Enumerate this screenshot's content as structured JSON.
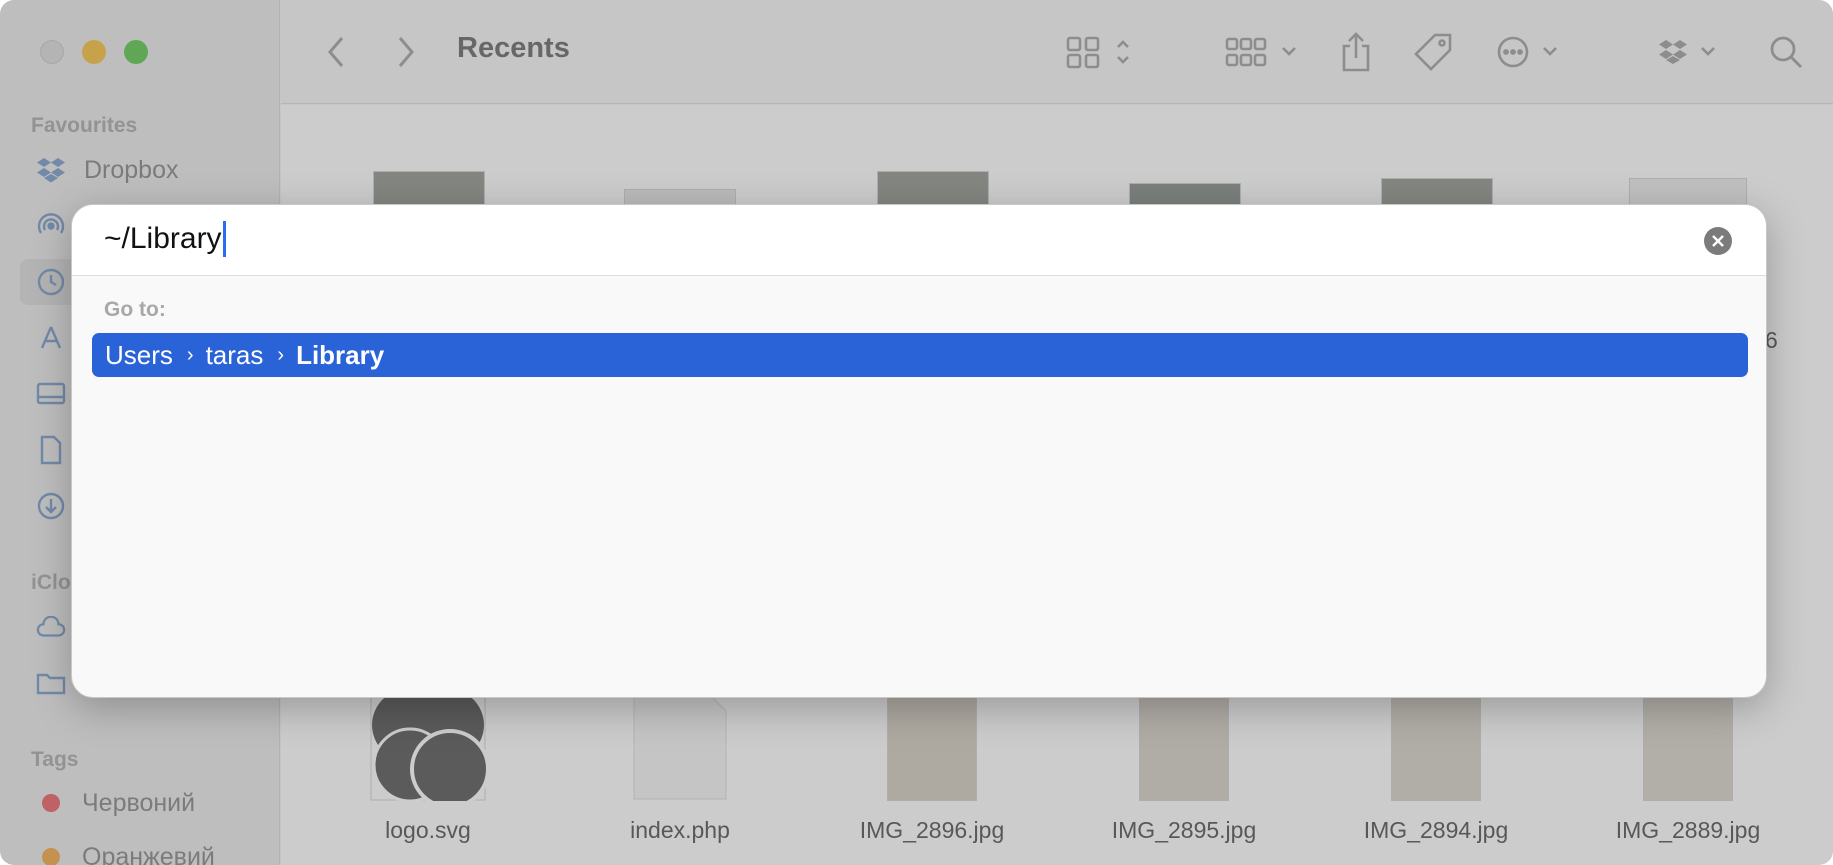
{
  "sidebar": {
    "sections": {
      "favourites": "Favourites",
      "icloud": "iClo",
      "tags": "Tags"
    },
    "favourites": [
      {
        "label": "Dropbox",
        "icon": "dropbox-icon"
      },
      {
        "label": "",
        "icon": "airdrop-icon"
      },
      {
        "label": "",
        "icon": "recents-icon"
      },
      {
        "label": "",
        "icon": "applications-icon"
      },
      {
        "label": "",
        "icon": "desktop-icon"
      },
      {
        "label": "",
        "icon": "documents-icon"
      },
      {
        "label": "",
        "icon": "downloads-icon"
      }
    ],
    "icloud": [
      {
        "icon": "icloud-drive-icon"
      },
      {
        "icon": "shared-folder-icon"
      }
    ],
    "tags": [
      {
        "label": "Червоний",
        "color": "#e8545a"
      },
      {
        "label": "Оранжевий",
        "color": "#f2a238"
      }
    ]
  },
  "toolbar": {
    "title": "Recents"
  },
  "files": {
    "row2": [
      {
        "name": "logo.svg"
      },
      {
        "name": "index.php"
      },
      {
        "name": "IMG_2896.jpg"
      },
      {
        "name": "IMG_2895.jpg"
      },
      {
        "name": "IMG_2894.jpg"
      },
      {
        "name": "IMG_2889.jpg"
      }
    ],
    "partial_label": "6"
  },
  "dialog": {
    "input_value": "~/Library",
    "goto_label": "Go to:",
    "result": {
      "crumbs": [
        "Users",
        "taras",
        "Library"
      ],
      "separator": "›"
    }
  },
  "colors": {
    "selection": "#2a63d8",
    "caret": "#2a6cf0"
  }
}
